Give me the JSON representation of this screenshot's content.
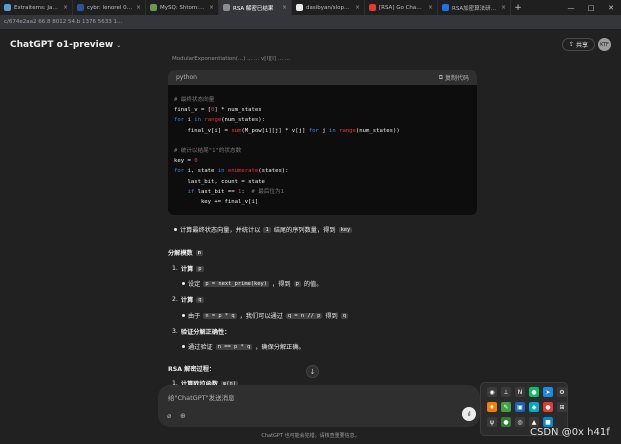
{
  "browser": {
    "tabs": [
      {
        "label": "Extraitems: Java Tools",
        "color": "#5b9bd5",
        "active": false
      },
      {
        "label": "cybr: lenorel 0 0 2.5%...",
        "color": "#2b579a",
        "active": false
      },
      {
        "label": "MySQ: Shtom: connections",
        "color": "#6a9955",
        "active": false
      },
      {
        "label": "RSA 解密已结果",
        "color": "#8e8e8e",
        "active": true
      },
      {
        "label": "dasibyan/slopepifra...",
        "color": "#ececec",
        "active": false
      },
      {
        "label": "[RSA] Go Chan Sol...",
        "color": "#e53935",
        "active": false
      },
      {
        "label": "RSA加密算法研究...",
        "color": "#1a73e8",
        "active": false
      }
    ],
    "new_tab": "+",
    "window_controls": [
      "—",
      "□",
      "✕"
    ],
    "url": "c/674e2aa2 66.8 8012 54.b 1376 5633 1..."
  },
  "header": {
    "model_title": "ChatGPT o1-preview",
    "share_label": "共享",
    "avatar_text": "KTF"
  },
  "cut_line": "ModularExponentiation(...) ... ... v[l][l] ... ...",
  "code": {
    "language": "python",
    "copy_label": "复制代码"
  },
  "prose": {
    "bullet_intro": "计算最终状态向量，并统计以",
    "bullet_intro_code": "1",
    "bullet_intro_rest": "结尾的序列数量，得到",
    "bullet_intro_key": "key",
    "section1_title": "分解模数",
    "section1_code": "n",
    "step1_label": "计算",
    "step1_code": "p",
    "step1_bullet_pre": "设定",
    "step1_bullet_code": "p = next_prime(key)",
    "step1_bullet_post": "，得到",
    "step1_bullet_code2": "p",
    "step1_bullet_end": "的值。",
    "step2_label": "计算",
    "step2_code": "q",
    "step2_bullet_pre": "由于",
    "step2_bullet_code": "n = p * q",
    "step2_bullet_mid": "，我们可以通过",
    "step2_bullet_code2": "q = n // p",
    "step2_bullet_post": "得到",
    "step2_bullet_code3": "q",
    "step3_label": "验证分解正确性：",
    "step3_bullet_pre": "通过验证",
    "step3_bullet_code": "n == p * q",
    "step3_bullet_post": "，确保分解正确。",
    "section2_title": "RSA 解密过程：",
    "step4_label": "计算欧拉函数",
    "step4_code": "φ(n)"
  },
  "scroll_down": "↓",
  "composer": {
    "placeholder": "给\"ChatGPT\"发送消息"
  },
  "footer": "ChatGPT 也可能会犯错。请核查重要信息。",
  "tray_icons": [
    {
      "glyph": "◉",
      "color": "#3a3a3a"
    },
    {
      "glyph": "⊥",
      "color": "#3a3a3a"
    },
    {
      "glyph": "N",
      "color": "#3a3a3a"
    },
    {
      "glyph": "●",
      "color": "#07c160"
    },
    {
      "glyph": "➤",
      "color": "#1e88e5"
    },
    {
      "glyph": "⚙",
      "color": "#3a3a3a"
    },
    {
      "glyph": "♦",
      "color": "#f57c00"
    },
    {
      "glyph": "✎",
      "color": "#43a047"
    },
    {
      "glyph": "▣",
      "color": "#1565c0"
    },
    {
      "glyph": "◆",
      "color": "#00acc1"
    },
    {
      "glyph": "●",
      "color": "#e53935"
    },
    {
      "glyph": "⊞",
      "color": "#3a3a3a"
    },
    {
      "glyph": "ψ",
      "color": "#3a3a3a"
    },
    {
      "glyph": "●",
      "color": "#2e7d32"
    },
    {
      "glyph": "◎",
      "color": "#3a3a3a"
    },
    {
      "glyph": "▲",
      "color": "#3a3a3a"
    },
    {
      "glyph": "■",
      "color": "#0288d1"
    }
  ],
  "watermark": "CSDN @0x h41f"
}
